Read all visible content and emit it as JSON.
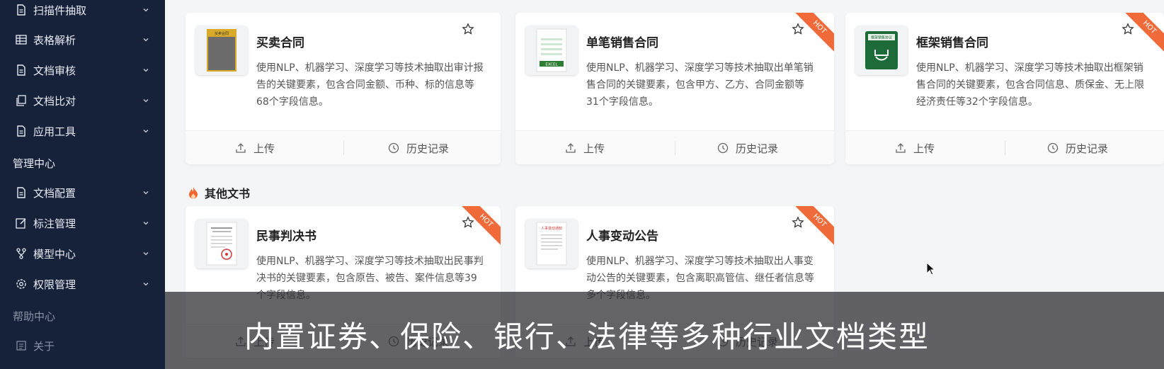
{
  "sidebar": {
    "items": [
      {
        "label": "扫描件抽取",
        "icon": "document-icon"
      },
      {
        "label": "表格解析",
        "icon": "table-icon"
      },
      {
        "label": "文档审核",
        "icon": "document-icon"
      },
      {
        "label": "文档比对",
        "icon": "copy-icon"
      },
      {
        "label": "应用工具",
        "icon": "document-icon"
      }
    ],
    "section_manage": "管理中心",
    "manage_items": [
      {
        "label": "文档配置",
        "icon": "document-icon"
      },
      {
        "label": "标注管理",
        "icon": "edit-icon"
      },
      {
        "label": "模型中心",
        "icon": "branch-icon"
      },
      {
        "label": "权限管理",
        "icon": "gear-icon"
      }
    ],
    "section_help": "帮助中心",
    "help_items": [
      {
        "label": "关于",
        "icon": "list-icon"
      }
    ]
  },
  "cards_top": [
    {
      "title": "买卖合同",
      "desc": "使用NLP、机器学习、深度学习等技术抽取出审计报告的关键要素，包含合同金额、币种、标的信息等68个字段信息。",
      "hot": false,
      "thumb_text": "买卖合同"
    },
    {
      "title": "单笔销售合同",
      "desc": "使用NLP、机器学习、深度学习等技术抽取出单笔销售合同的关键要素，包含甲方、乙方、合同金额等31个字段信息。",
      "hot": true,
      "thumb_text": "EXCEL"
    },
    {
      "title": "框架销售合同",
      "desc": "使用NLP、机器学习、深度学习等技术抽取出框架销售合同的关键要素，包含合同信息、质保金、无上限经济责任等32个字段信息。",
      "hot": true,
      "thumb_text": "框架销售协议"
    }
  ],
  "section_other": "其他文书",
  "cards_bottom": [
    {
      "title": "民事判决书",
      "desc": "使用NLP、机器学习、深度学习等技术抽取出民事判决书的关键要素，包含原告、被告、案件信息等39个字段信息。",
      "hot": true
    },
    {
      "title": "人事变动公告",
      "desc": "使用NLP、机器学习、深度学习等技术抽取出人事变动公告的关键要素，包含离职高管信、继任者信息等多个字段信息。",
      "hot": true,
      "thumb_text": "人事变动通知"
    }
  ],
  "actions": {
    "upload": "上传",
    "history": "历史记录"
  },
  "hot_label": "HOT",
  "caption": "内置证券、保险、银行、法律等多种行业文档类型",
  "colors": {
    "sidebar": "#16213a",
    "hot": "#f06a3a",
    "flame": "#f0642e"
  }
}
